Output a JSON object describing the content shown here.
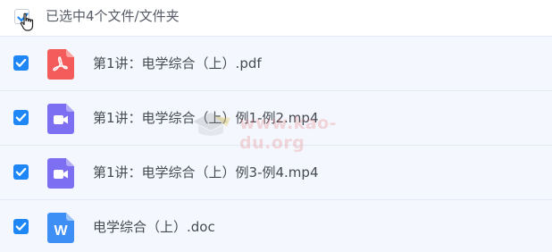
{
  "header": {
    "selection_label": "已选中4个文件/文件夹",
    "checked": true
  },
  "files": [
    {
      "name": "第1讲：电学综合（上）.pdf",
      "type": "pdf",
      "icon": "pdf-icon",
      "icon_color": "#f45b5b",
      "checked": true
    },
    {
      "name": "第1讲：电学综合（上）例1-例2.mp4",
      "type": "video",
      "icon": "video-icon",
      "icon_color": "#7c6ff2",
      "checked": true
    },
    {
      "name": "第1讲：电学综合（上）例3-例4.mp4",
      "type": "video",
      "icon": "video-icon",
      "icon_color": "#7c6ff2",
      "checked": true
    },
    {
      "name": "电学综合（上）.doc",
      "type": "word",
      "icon": "word-icon",
      "icon_color": "#3d8ef5",
      "icon_letter": "W",
      "checked": true
    }
  ],
  "watermark": {
    "text": "www.kao-du.org"
  },
  "colors": {
    "accent": "#1f86f6",
    "row_background": "#f4f8fe"
  }
}
